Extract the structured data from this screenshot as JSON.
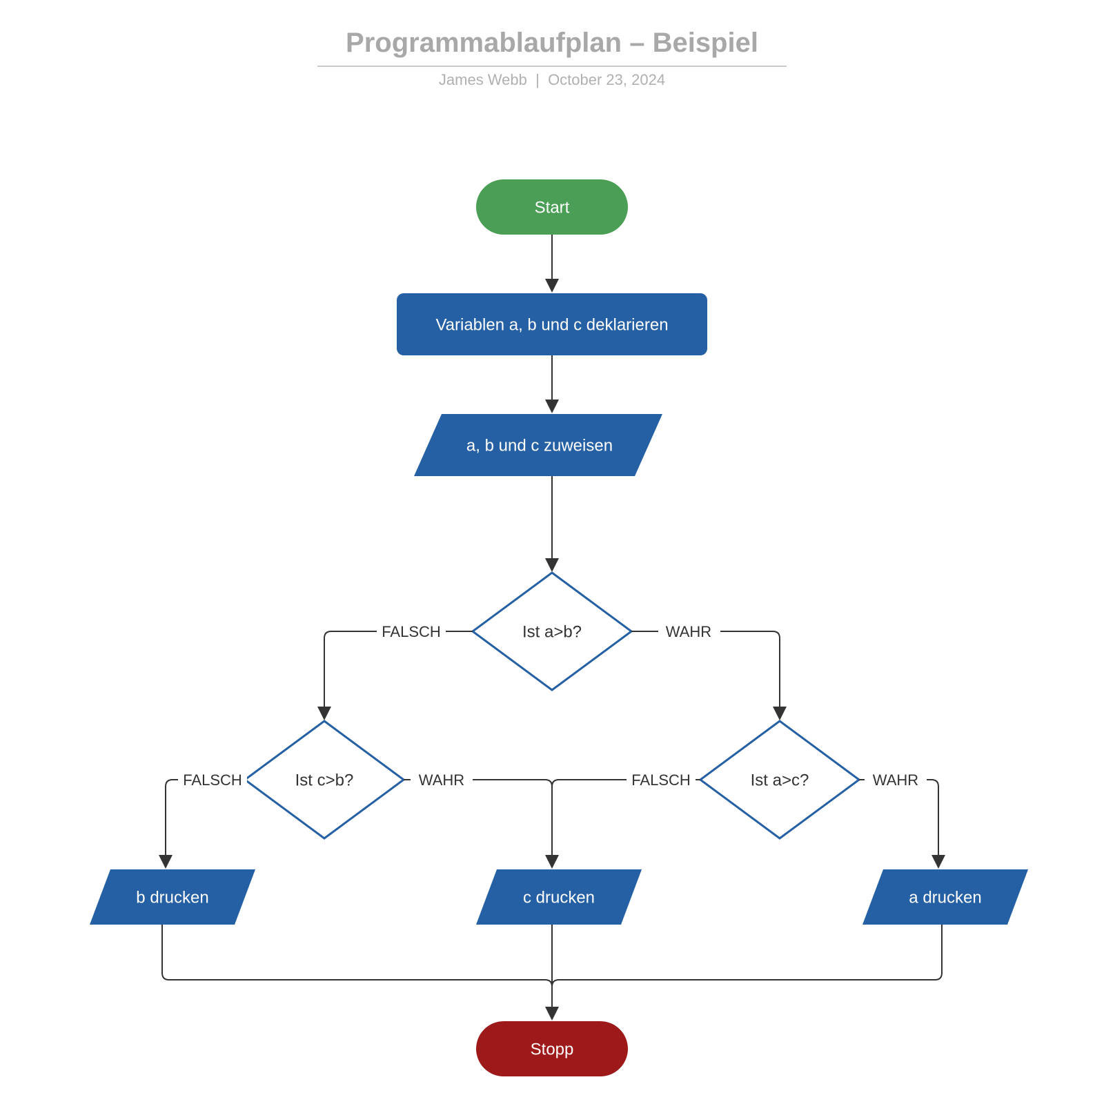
{
  "title": "Programmablaufplan – Beispiel",
  "author": "James Webb",
  "date": "October 23, 2024",
  "nodes": {
    "start": "Start",
    "declare": "Variablen a, b und c deklarieren",
    "assign": "a, b und c zuweisen",
    "d1": "Ist a>b?",
    "d2": "Ist c>b?",
    "d3": "Ist a>c?",
    "out_b": "b drucken",
    "out_c": "c drucken",
    "out_a": "a drucken",
    "stop": "Stopp"
  },
  "labels": {
    "true": "WAHR",
    "false": "FALSCH"
  },
  "colors": {
    "start": "#4a9e55",
    "stop": "#9e1a1a",
    "process": "#2660a4",
    "decisionStroke": "#2660a4",
    "arrow": "#333333"
  }
}
